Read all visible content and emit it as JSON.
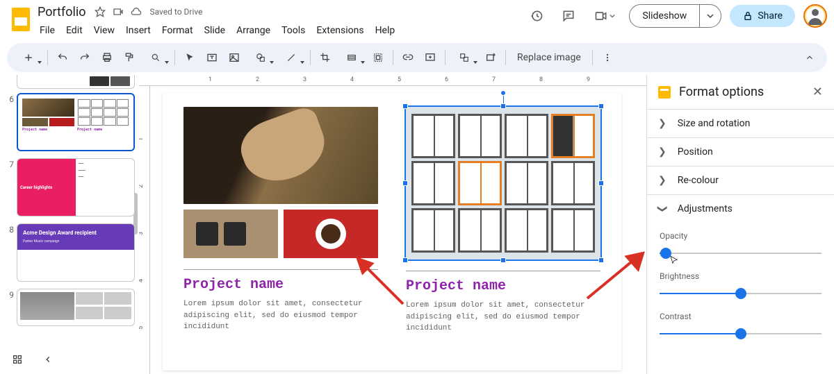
{
  "doc": {
    "title": "Portfolio",
    "saved": "Saved to Drive"
  },
  "menus": [
    "File",
    "Edit",
    "View",
    "Insert",
    "Format",
    "Slide",
    "Arrange",
    "Tools",
    "Extensions",
    "Help"
  ],
  "top_buttons": {
    "slideshow": "Slideshow",
    "share": "Share"
  },
  "toolbar": {
    "replace": "Replace image"
  },
  "ruler_h": [
    "1",
    "2",
    "3",
    "4",
    "5",
    "6",
    "7",
    "8",
    "9"
  ],
  "ruler_v": [
    "1",
    "2",
    "3",
    "4",
    "5"
  ],
  "filmstrip": {
    "slides": [
      {
        "num": "6",
        "selected": true,
        "proj_label": "Project name"
      },
      {
        "num": "7",
        "title": "Career highlights",
        "lines": [
          "UX Director",
          "",
          "Sr. Designer",
          "",
          "Designer",
          ""
        ]
      },
      {
        "num": "8",
        "title": "Acme Design Award recipient",
        "sub": "Parker Music campaign"
      },
      {
        "num": "9"
      }
    ]
  },
  "slide": {
    "left": {
      "project_name": "Project name",
      "desc": "Lorem ipsum dolor sit amet, consectetur adipiscing elit, sed do eiusmod tempor incididunt"
    },
    "right": {
      "project_name": "Project name",
      "desc": "Lorem ipsum dolor sit amet, consectetur adipiscing elit, sed do eiusmod tempor incididunt"
    }
  },
  "panel": {
    "title": "Format options",
    "sections": {
      "size": "Size and rotation",
      "position": "Position",
      "recolour": "Re-colour",
      "adjustments": "Adjustments"
    },
    "sliders": {
      "opacity": {
        "label": "Opacity",
        "value": 4
      },
      "brightness": {
        "label": "Brightness",
        "value": 50
      },
      "contrast": {
        "label": "Contrast",
        "value": 50
      }
    }
  }
}
